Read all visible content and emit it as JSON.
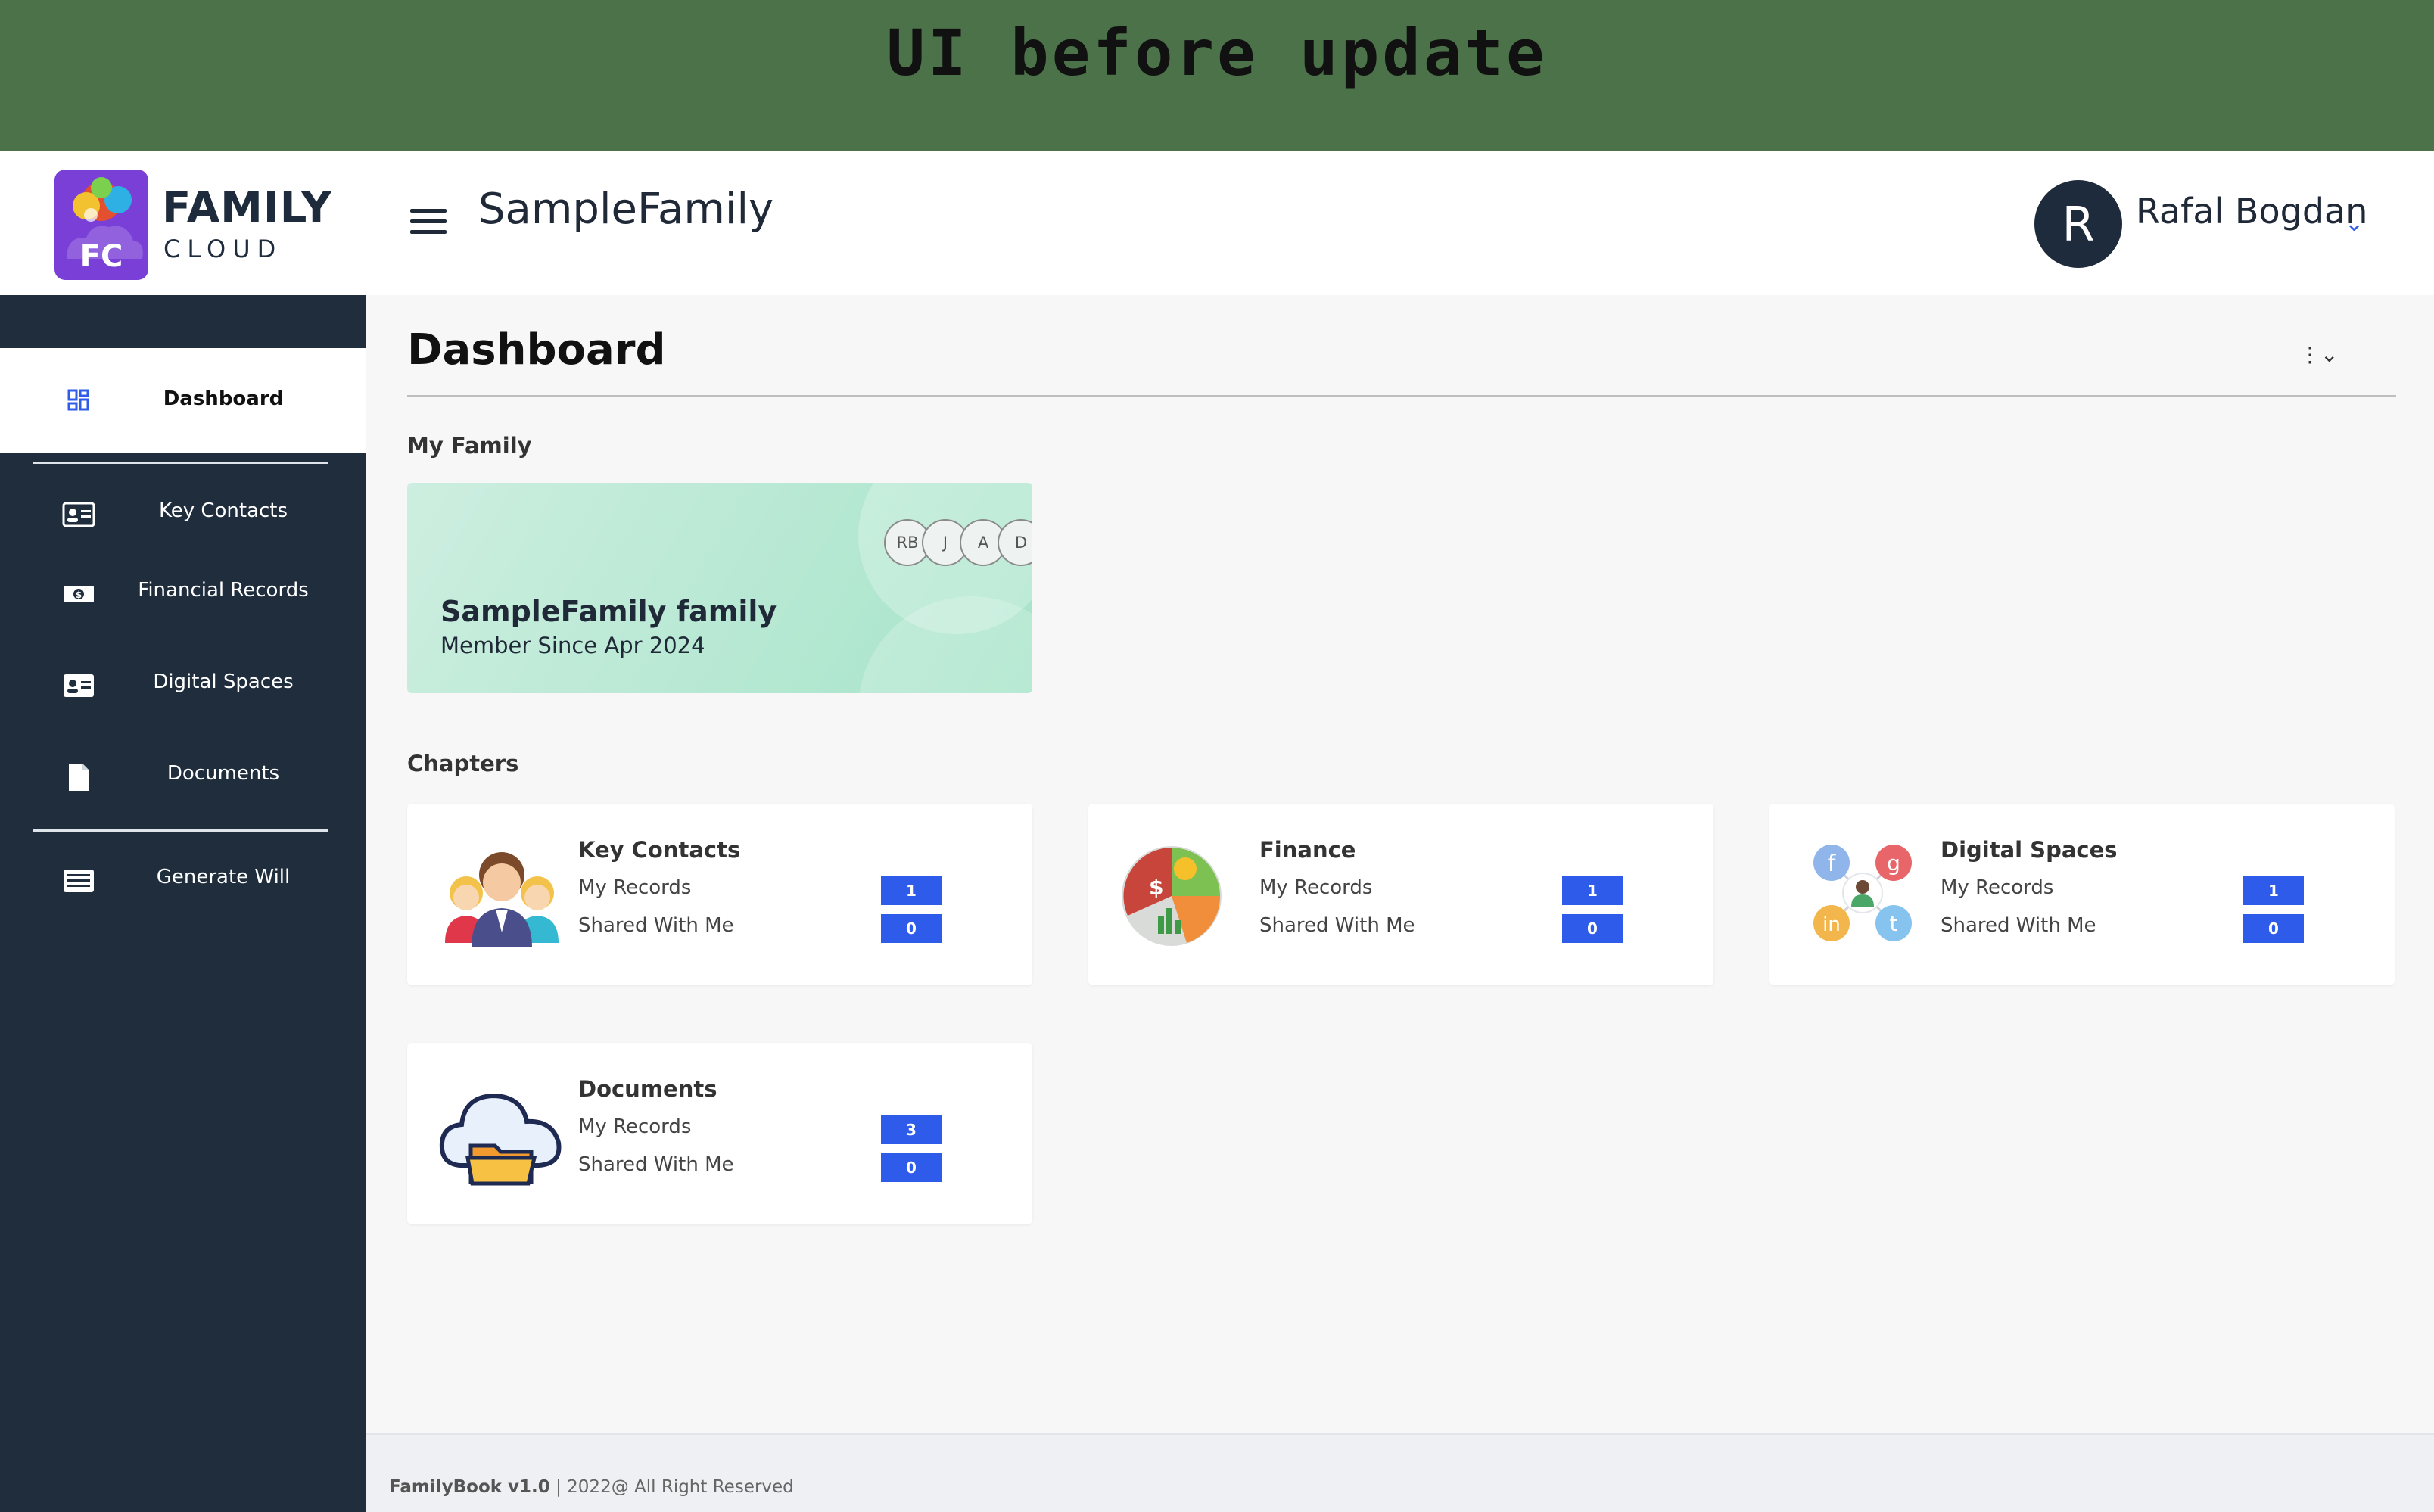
{
  "banner": {
    "text": "UI before update"
  },
  "header": {
    "logo": {
      "word_top": "FAMILY",
      "word_bottom": "CLOUD",
      "mark_text": "FC"
    },
    "family_title": "SampleFamily",
    "user": {
      "initial": "R",
      "name": "Rafal Bogdan",
      "chevron": "⌄"
    }
  },
  "sidebar": {
    "items": [
      {
        "label": "Dashboard",
        "icon": "dashboard-icon",
        "active": true
      },
      {
        "label": "Key Contacts",
        "icon": "contact-card-icon"
      },
      {
        "label": "Financial Records",
        "icon": "money-icon"
      },
      {
        "label": "Digital Spaces",
        "icon": "id-card-icon"
      },
      {
        "label": "Documents",
        "icon": "document-icon"
      },
      {
        "label": "Generate Will",
        "icon": "list-icon"
      }
    ]
  },
  "main": {
    "title": "Dashboard",
    "more_menu": "⋮⌄",
    "my_family": {
      "section_label": "My Family",
      "family_name": "SampleFamily family",
      "member_since": "Member Since Apr 2024",
      "members": [
        "RB",
        "J",
        "A",
        "D"
      ]
    },
    "chapters": {
      "section_label": "Chapters",
      "cards": [
        {
          "title": "Key Contacts",
          "my_records_label": "My Records",
          "my_records": "1",
          "shared_label": "Shared With Me",
          "shared": "0",
          "icon": "people-icon"
        },
        {
          "title": "Finance",
          "my_records_label": "My Records",
          "my_records": "1",
          "shared_label": "Shared With Me",
          "shared": "0",
          "icon": "finance-pie-icon"
        },
        {
          "title": "Digital Spaces",
          "my_records_label": "My Records",
          "my_records": "1",
          "shared_label": "Shared With Me",
          "shared": "0",
          "icon": "social-network-icon"
        },
        {
          "title": "Documents",
          "my_records_label": "My Records",
          "my_records": "3",
          "shared_label": "Shared With Me",
          "shared": "0",
          "icon": "cloud-folder-icon"
        }
      ]
    }
  },
  "footer": {
    "product": "FamilyBook v1.0",
    "rights": " | 2022@ All Right Reserved"
  },
  "colors": {
    "sidebar": "#1f2d3d",
    "accent": "#2f5bea",
    "banner": "#4c724a",
    "card_green": "#a6e4c9"
  }
}
